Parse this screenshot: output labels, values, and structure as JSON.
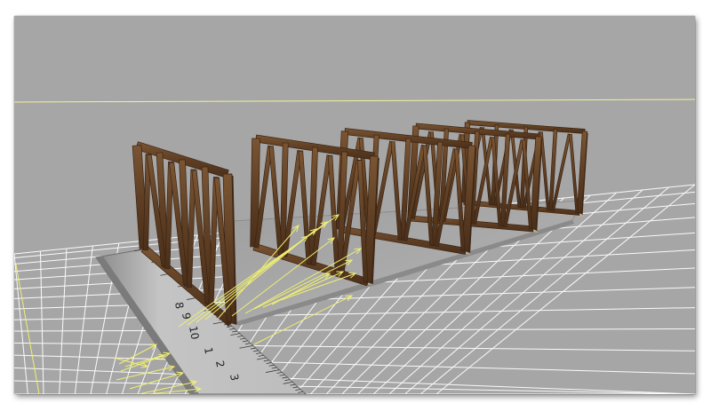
{
  "viewport": {
    "background_color": "#a6a6a6",
    "grid_color": "#ffffff",
    "horizon_line_color": "#f2f29a",
    "guide_line_color": "#f0f070"
  },
  "model": {
    "timber_color": "#5a3c22",
    "panel_count": 5
  },
  "ruler": {
    "color": "#b8b8b8",
    "numbers": [
      "8",
      "9",
      "10",
      "1",
      "2",
      "3"
    ]
  }
}
